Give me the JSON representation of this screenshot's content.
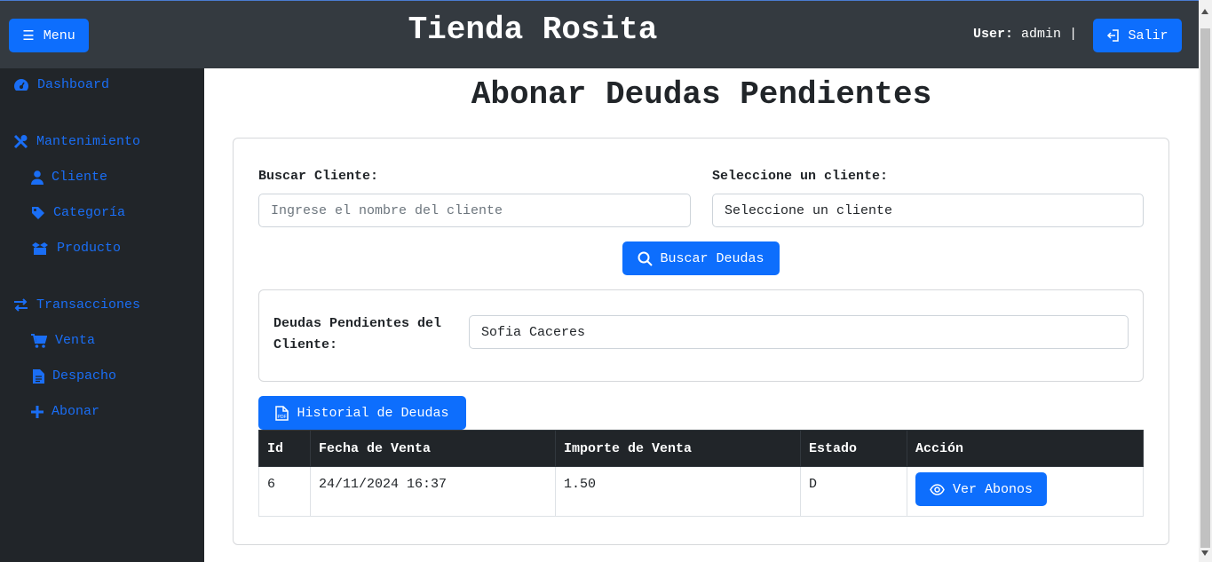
{
  "header": {
    "menu_label": "Menu",
    "app_title": "Tienda Rosita",
    "user_label": "User:",
    "user_name": "admin",
    "separator": "|",
    "logout_label": "Salir"
  },
  "sidebar": {
    "dashboard": "Dashboard",
    "mantenimiento": "Mantenimiento",
    "cliente": "Cliente",
    "categoria": "Categoría",
    "producto": "Producto",
    "transacciones": "Transacciones",
    "venta": "Venta",
    "despacho": "Despacho",
    "abonar": "Abonar"
  },
  "page": {
    "title": "Abonar Deudas Pendientes"
  },
  "search": {
    "buscar_label": "Buscar Cliente:",
    "buscar_placeholder": "Ingrese el nombre del cliente",
    "select_label": "Seleccione un cliente:",
    "select_value": "Seleccione un cliente",
    "button": "Buscar Deudas"
  },
  "debts": {
    "label": "Deudas Pendientes del Cliente:",
    "client_value": "Sofia Caceres",
    "history_button": "Historial de Deudas"
  },
  "table": {
    "headers": [
      "Id",
      "Fecha de Venta",
      "Importe de Venta",
      "Estado",
      "Acción"
    ],
    "rows": [
      {
        "id": "6",
        "fecha": "24/11/2024 16:37",
        "importe": "1.50",
        "estado": "D",
        "accion": "Ver Abonos"
      }
    ]
  },
  "colors": {
    "accent": "#0d6efd",
    "topbar": "#343a40",
    "sidebar": "#212529"
  }
}
